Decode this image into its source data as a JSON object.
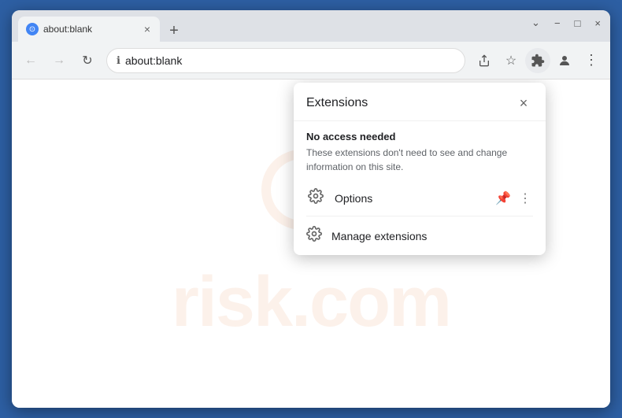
{
  "browser": {
    "tab": {
      "favicon": "⊙",
      "title": "about:blank",
      "close_label": "×"
    },
    "new_tab_label": "+",
    "window_controls": {
      "minimize": "−",
      "maximize": "□",
      "close": "×",
      "down": "⌄"
    },
    "toolbar": {
      "back_label": "←",
      "forward_label": "→",
      "reload_label": "↻",
      "address": "about:blank",
      "share_icon": "share",
      "bookmark_icon": "☆",
      "extensions_icon": "🧩",
      "profile_icon": "👤",
      "menu_icon": "⋮"
    }
  },
  "extensions_popup": {
    "title": "Extensions",
    "close_label": "×",
    "section_title": "No access needed",
    "section_desc": "These extensions don't need to see and change\ninformation on this site.",
    "options_label": "Options",
    "pin_icon": "📌",
    "more_icon": "⋮",
    "manage_label": "Manage extensions",
    "manage_icon": "⚙"
  },
  "watermark": {
    "text": "risk.com"
  }
}
